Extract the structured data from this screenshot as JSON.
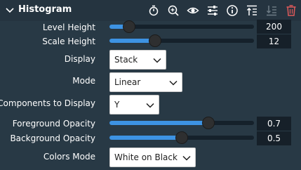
{
  "panel": {
    "title": "Histogram",
    "toolbar": [
      {
        "name": "timer-icon"
      },
      {
        "name": "zoom-icon"
      },
      {
        "name": "eye-icon"
      },
      {
        "name": "sliders-icon"
      },
      {
        "name": "info-icon"
      },
      {
        "name": "move-to-top-icon"
      },
      {
        "name": "move-down-icon"
      },
      {
        "name": "trash-icon"
      }
    ]
  },
  "level_height": {
    "label": "Level Height",
    "value": "200",
    "fraction": 0.1
  },
  "scale_height": {
    "label": "Scale Height",
    "value": "12",
    "fraction": 0.3
  },
  "display": {
    "label": "Display",
    "selected": "Stack"
  },
  "mode": {
    "label": "Mode",
    "selected": "Linear"
  },
  "components": {
    "label": "Components to Display",
    "selected": "Y"
  },
  "foreground_opacity": {
    "label": "Foreground Opacity",
    "value": "0.7",
    "fraction": 0.7
  },
  "background_opacity": {
    "label": "Background Opacity",
    "value": "0.5",
    "fraction": 0.5
  },
  "colors_mode": {
    "label": "Colors Mode",
    "selected": "White on Black"
  },
  "colors": {
    "accent": "#3d93e3",
    "trash": "#e05a5a",
    "disabled": "#6e7c86"
  }
}
